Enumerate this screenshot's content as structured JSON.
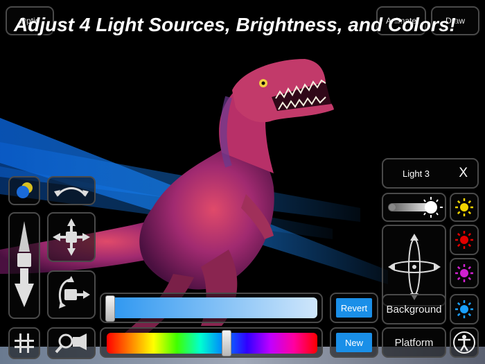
{
  "toolbar": {
    "options_label": "Optio",
    "animate_label": "Animate",
    "draw_label": "Draw"
  },
  "headline": "Adjust 4 Light Sources, Brightness, and Colors!",
  "light_panel": {
    "title": "Light 3",
    "close_label": "X",
    "background_label": "Background",
    "platform_label": "Platform"
  },
  "color_controls": {
    "revert_label": "Revert",
    "new_label": "New",
    "brightness_level": 0.0,
    "hue_level": 0.58
  },
  "light_colors": [
    "#f2d400",
    "#e00000",
    "#d020d0",
    "#1aa0ff"
  ],
  "icons": {
    "spheres": "spheres-icon",
    "rotate_arc": "rotate-arc-icon",
    "camera_dolly": "camera-dolly-icon",
    "camera_pan": "camera-pan-icon",
    "camera_rotate": "camera-rotate-icon",
    "grid": "grid-icon",
    "zoom": "zoom-icon",
    "brightness": "brightness-slider-icon",
    "light_direction": "light-direction-icon",
    "accessibility": "person-icon"
  }
}
